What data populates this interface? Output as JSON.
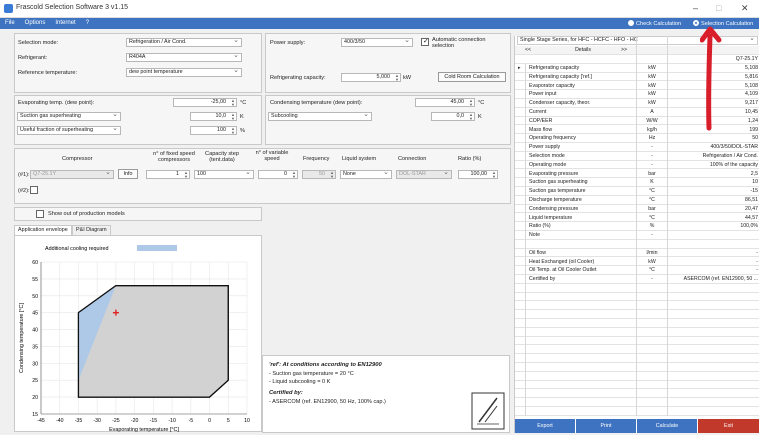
{
  "window": {
    "title": "Frascold Selection Software 3 v1.15",
    "minimize": "–",
    "maximize": "□",
    "close": "✕"
  },
  "menu": [
    "File",
    "Options",
    "Internet",
    "?"
  ],
  "mode_radios": {
    "check": "Check Calculation",
    "selection": "Selection Calculation"
  },
  "form": {
    "selection_mode_label": "Selection mode:",
    "selection_mode": "Refrigeration / Air Cond.",
    "refrigerant_label": "Refrigerant:",
    "refrigerant": "R404A",
    "reference_temp_label": "Reference temperature:",
    "reference_temp": "dew point temperature",
    "power_supply_label": "Power supply:",
    "power_supply": "400/3/50",
    "auto_conn_label": "Automatic connection selection",
    "refrig_capacity_label": "Refrigerating capacity:",
    "refrig_capacity": "5,000",
    "refrig_capacity_unit": "kW",
    "cold_room_button": "Cold Room Calculation",
    "evap_temp_label": "Evaporating temp. (dew point):",
    "evap_temp": "-25,00",
    "evap_temp_unit": "°C",
    "suction_superheat_label": "Suction gas superheating",
    "suction_superheat": "10,0",
    "suction_superheat_unit": "K",
    "useful_fraction_label": "Useful fraction of superheating",
    "useful_fraction": "100",
    "useful_fraction_unit": "%",
    "cond_temp_label": "Condensing temperature (dew point):",
    "cond_temp": "45,00",
    "cond_temp_unit": "°C",
    "subcooling_label": "Subcooling",
    "subcooling": "0,0",
    "subcooling_unit": "K"
  },
  "compressor": {
    "headers": {
      "compressor": "Compressor",
      "n_fixed": "n° of fixed speed compressors",
      "cap_step": "Capacity step (tent.data)",
      "n_var": "n° of variable speed",
      "frequency": "Frequency",
      "liquid": "Liquid system",
      "connection": "Connection",
      "ratio": "Ratio (%)"
    },
    "row1_label": "(#1):",
    "row2_label": "(#2):",
    "model": "Q7-25.1Y",
    "info_button": "Info",
    "n_fixed": "1",
    "cap_step": "100",
    "n_var": "0",
    "frequency": "50",
    "liquid": "None",
    "connection": "DOL-STAR",
    "ratio": "100,00"
  },
  "show_out_label": "Show out of production models",
  "tabs": [
    "Application envelope",
    "P&I Diagram"
  ],
  "chart_data": {
    "type": "area",
    "title": "",
    "legend": [
      "Additional cooling required"
    ],
    "xlabel": "Evaporating temperature [°C]",
    "ylabel": "Condensing temperature [°C]",
    "xlim": [
      -45,
      10
    ],
    "ylim": [
      15,
      60
    ],
    "xticks": [
      -45,
      -40,
      -35,
      -30,
      -25,
      -20,
      -15,
      -10,
      -5,
      0,
      5,
      10
    ],
    "yticks": [
      15,
      20,
      25,
      30,
      35,
      40,
      45,
      50,
      55,
      60
    ],
    "grid": true,
    "envelope": [
      [
        -35,
        45
      ],
      [
        -25,
        53
      ],
      [
        5,
        53
      ],
      [
        5,
        25
      ],
      [
        0,
        20
      ],
      [
        -35,
        20
      ]
    ],
    "cooling_region": [
      [
        -35,
        45
      ],
      [
        -25,
        53
      ],
      [
        -35,
        25
      ]
    ],
    "operating_point": {
      "x": -25,
      "y": 45
    }
  },
  "annotation": {
    "ref_title": "'ref': At conditions according to EN12900",
    "line1": "- Suction gas temperature = 20 °C",
    "line2": "- Liquid subcooling = 0 K",
    "certified_title": "Certified by:",
    "line3": "- ASERCOM (ref. EN12900, 50 Hz, 100% cap.)"
  },
  "results": {
    "header": "Single Stage Series, for HFC - HCFC - HFO - HC",
    "nav_prev": "<<",
    "details": "Details",
    "nav_next": ">>",
    "model": "Q7-25.1Y",
    "rows": [
      {
        "name": "Refrigerating capacity",
        "unit": "kW",
        "value": "5,108"
      },
      {
        "name": "Refrigerating capacity ['ref.]",
        "unit": "kW",
        "value": "5,816"
      },
      {
        "name": "Evaporator capacity",
        "unit": "kW",
        "value": "5,108"
      },
      {
        "name": "Power input",
        "unit": "kW",
        "value": "4,109"
      },
      {
        "name": "Condenser capacity, theor.",
        "unit": "kW",
        "value": "9,217"
      },
      {
        "name": "Current",
        "unit": "A",
        "value": "10,45"
      },
      {
        "name": "COP/EER",
        "unit": "W/W",
        "value": "1,24"
      },
      {
        "name": "Mass flow",
        "unit": "kg/h",
        "value": "199"
      },
      {
        "name": "Operating frequency",
        "unit": "Hz",
        "value": "50"
      },
      {
        "name": "Power supply",
        "unit": "-",
        "value": "400/3/50/DOL-STAR"
      },
      {
        "name": "Selection mode",
        "unit": "-",
        "value": "Refrigeration / Air Cond."
      },
      {
        "name": "Operating mode",
        "unit": "-",
        "value": "100% of the capacity"
      },
      {
        "name": "Evaporating pressure",
        "unit": "bar",
        "value": "2,5"
      },
      {
        "name": "Suction gas superheating",
        "unit": "K",
        "value": "10"
      },
      {
        "name": "Suction gas temperature",
        "unit": "°C",
        "value": "-15"
      },
      {
        "name": "Discharge temperature",
        "unit": "°C",
        "value": "86,51"
      },
      {
        "name": "Condensing pressure",
        "unit": "bar",
        "value": "20,47"
      },
      {
        "name": "Liquid temperature",
        "unit": "°C",
        "value": "44,57"
      },
      {
        "name": "Ratio (%)",
        "unit": "%",
        "value": "100,0%"
      },
      {
        "name": "Note",
        "unit": "-",
        "value": ""
      },
      {
        "name": "",
        "unit": "",
        "value": ""
      },
      {
        "name": "Oil flow",
        "unit": "l/min",
        "value": "-"
      },
      {
        "name": "Heat Exchanged (oil Cooler)",
        "unit": "kW",
        "value": "-"
      },
      {
        "name": "Oil Temp. at Oil Cooler Outlet",
        "unit": "°C",
        "value": "-"
      },
      {
        "name": "Certified by",
        "unit": "-",
        "value": "ASERCOM (ref. EN12900, 50 ..."
      }
    ]
  },
  "bottom_buttons": [
    {
      "label": "Export",
      "color": "#3d73c0"
    },
    {
      "label": "Print",
      "color": "#3d73c0"
    },
    {
      "label": "Calculate",
      "color": "#3d73c0"
    },
    {
      "label": "Exit",
      "color": "#c0392b"
    }
  ],
  "colors": {
    "accent": "#3d73c0",
    "envelope": "#d2d2d2",
    "cooling": "#aec8e8",
    "point": "#e02020",
    "arrow": "#d81e2a"
  }
}
